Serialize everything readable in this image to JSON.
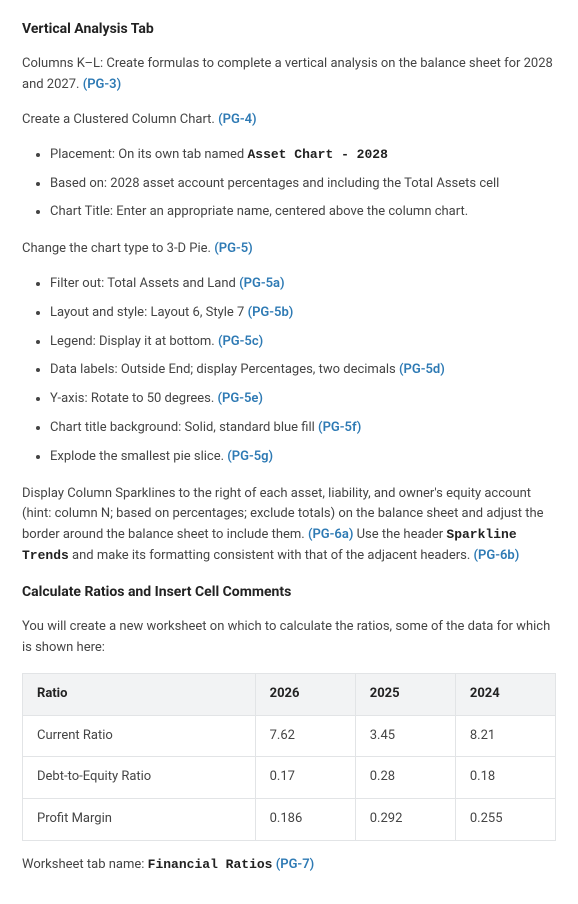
{
  "section1": {
    "heading": "Vertical Analysis Tab",
    "p1_a": "Columns K–L: Create formulas to complete a vertical analysis on the balance sheet for 2028 and 2027. ",
    "p1_ref": "(PG-3)",
    "p2_a": "Create a Clustered Column Chart. ",
    "p2_ref": "(PG-4)",
    "list1": {
      "i1_a": "Placement: On its own tab named ",
      "i1_mono": "Asset Chart - 2028",
      "i2": "Based on: 2028 asset account percentages and including the Total Assets cell",
      "i3": "Chart Title: Enter an appropriate name, centered above the column chart."
    },
    "p3_a": "Change the chart type to 3-D Pie. ",
    "p3_ref": "(PG-5)",
    "list2": {
      "i1_a": "Filter out: Total Assets and Land ",
      "i1_ref": "(PG-5a)",
      "i2_a": "Layout and style: Layout 6, Style 7 ",
      "i2_ref": "(PG-5b)",
      "i3_a": "Legend: Display it at bottom. ",
      "i3_ref": "(PG-5c)",
      "i4_a": "Data labels: Outside End; display Percentages, two decimals ",
      "i4_ref": "(PG-5d)",
      "i5_a": "Y-axis: Rotate to 50 degrees. ",
      "i5_ref": "(PG-5e)",
      "i6_a": "Chart title background: Solid, standard blue fill ",
      "i6_ref": "(PG-5f)",
      "i7_a": "Explode the smallest pie slice. ",
      "i7_ref": "(PG-5g)"
    },
    "p4_a": "Display Column Sparklines to the right of each asset, liability, and owner's equity account (hint: column N; based on percentages; exclude totals) on the balance sheet and adjust the border around the balance sheet to include them. ",
    "p4_ref": "(PG-6a)",
    "p4_b": " Use the header ",
    "p4_mono": "Sparkline Trends",
    "p4_c": " and make its formatting consistent with that of the adjacent headers. ",
    "p4_ref2": "(PG-6b)"
  },
  "section2": {
    "heading": "Calculate Ratios and Insert Cell Comments",
    "p1": "You will create a new worksheet on which to calculate the ratios, some of the data for which is shown here:",
    "table": {
      "headers": [
        "Ratio",
        "2026",
        "2025",
        "2024"
      ],
      "rows": [
        [
          "Current Ratio",
          "7.62",
          "3.45",
          "8.21"
        ],
        [
          "Debt-to-Equity Ratio",
          "0.17",
          "0.28",
          "0.18"
        ],
        [
          "Profit Margin",
          "0.186",
          "0.292",
          "0.255"
        ]
      ]
    },
    "p2_a": "Worksheet tab name: ",
    "p2_mono": "Financial Ratios",
    "p2_ref": " (PG-7)"
  }
}
